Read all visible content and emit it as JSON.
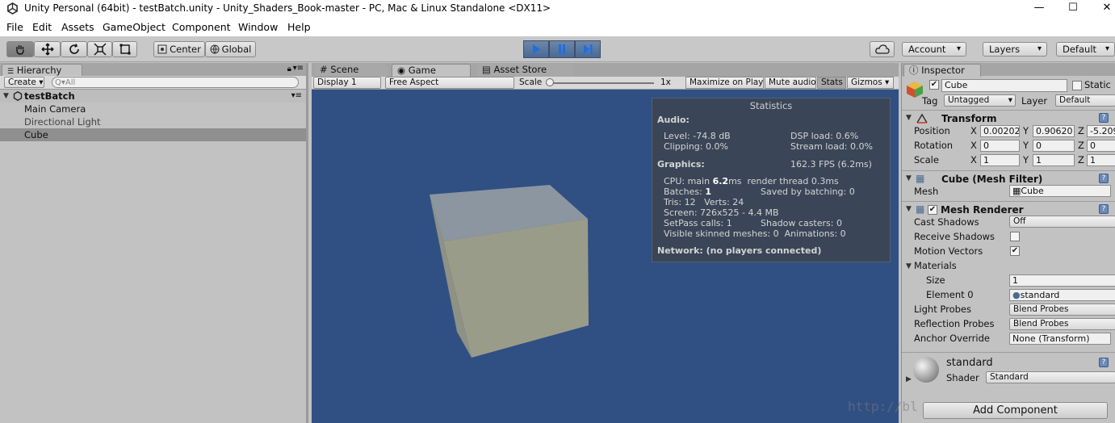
{
  "window": {
    "title": "Unity Personal (64bit) - testBatch.unity - Unity_Shaders_Book-master - PC, Mac & Linux Standalone <DX11>"
  },
  "menu": [
    "File",
    "Edit",
    "Assets",
    "GameObject",
    "Component",
    "Window",
    "Help"
  ],
  "toolbar": {
    "pivot": "Center",
    "space": "Global",
    "account": "Account",
    "layers": "Layers",
    "layout": "Default"
  },
  "hierarchy": {
    "tab": "Hierarchy",
    "create": "Create",
    "search_placeholder": "Q▾All",
    "scene": "testBatch",
    "items": [
      "Main Camera",
      "Directional Light",
      "Cube"
    ],
    "selected": "Cube"
  },
  "game": {
    "tabs": [
      "Scene",
      "Game",
      "Asset Store"
    ],
    "display": "Display 1",
    "aspect": "Free Aspect",
    "scale_label": "Scale",
    "scale_value": "1x",
    "maximize": "Maximize on Play",
    "mute": "Mute audio",
    "stats": "Stats",
    "gizmos": "Gizmos"
  },
  "statistics": {
    "title": "Statistics",
    "audio_header": "Audio:",
    "level": "Level: -74.8 dB",
    "dsp": "DSP load: 0.6%",
    "clipping": "Clipping: 0.0%",
    "stream": "Stream load: 0.0%",
    "graphics_header": "Graphics:",
    "fps": "162.3 FPS (6.2ms)",
    "cpu_prefix": "CPU: main ",
    "cpu_main": "6.2",
    "cpu_suffix": "ms  render thread 0.3ms",
    "batches_prefix": "Batches: ",
    "batches": "1",
    "saved": "Saved by batching: 0",
    "tris": "Tris: 12   Verts: 24",
    "screen": "Screen: 726x525 - 4.4 MB",
    "setpass": "SetPass calls: 1",
    "shadow": "Shadow casters: 0",
    "skinned": "Visible skinned meshes: 0  Animations: 0",
    "network": "Network: (no players connected)"
  },
  "inspector": {
    "tab": "Inspector",
    "name": "Cube",
    "static": "Static",
    "tag_label": "Tag",
    "tag": "Untagged",
    "layer_label": "Layer",
    "layer": "Default",
    "transform": "Transform",
    "position": {
      "label": "Position",
      "x": "0.00202",
      "y": "0.90620",
      "z": "-5.209"
    },
    "rotation": {
      "label": "Rotation",
      "x": "0",
      "y": "0",
      "z": "0"
    },
    "scale": {
      "label": "Scale",
      "x": "1",
      "y": "1",
      "z": "1"
    },
    "mesh_filter": "Cube (Mesh Filter)",
    "mesh_label": "Mesh",
    "mesh": "Cube",
    "mesh_renderer": "Mesh Renderer",
    "cast_shadows_label": "Cast Shadows",
    "cast_shadows": "Off",
    "receive_shadows": "Receive Shadows",
    "motion_vectors": "Motion Vectors",
    "materials": "Materials",
    "size_label": "Size",
    "size": "1",
    "element0_label": "Element 0",
    "element0": "standard",
    "light_probes_label": "Light Probes",
    "light_probes": "Blend Probes",
    "reflection_probes_label": "Reflection Probes",
    "reflection_probes": "Blend Probes",
    "anchor_label": "Anchor Override",
    "anchor": "None (Transform)",
    "material_name": "standard",
    "shader_label": "Shader",
    "shader": "Standard",
    "add_component": "Add Component"
  },
  "watermark": "http://bl"
}
